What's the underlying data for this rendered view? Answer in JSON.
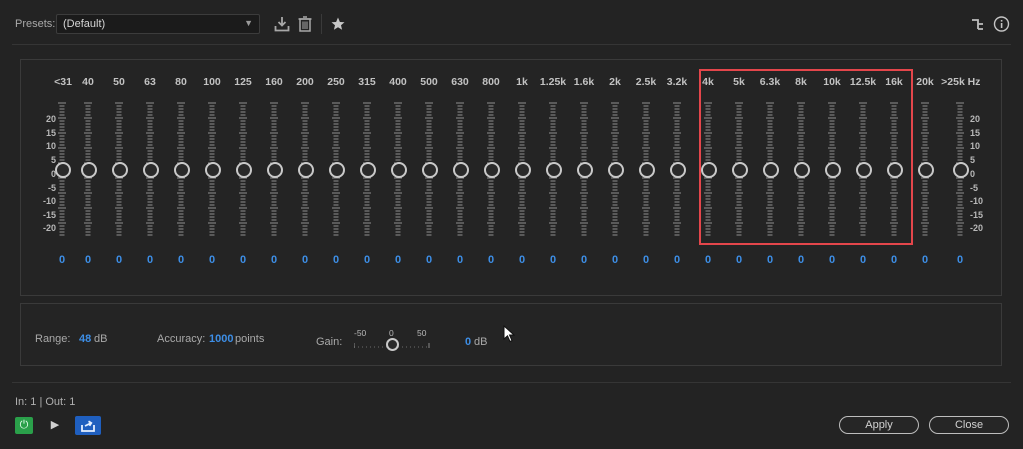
{
  "header": {
    "presets_label": "Presets:",
    "preset_value": "(Default)",
    "icons": [
      "save-preset-icon",
      "delete-preset-icon",
      "favorite-star-icon",
      "routing-icon",
      "info-icon"
    ]
  },
  "eq": {
    "bands": [
      "<31",
      "40",
      "50",
      "63",
      "80",
      "100",
      "125",
      "160",
      "200",
      "250",
      "315",
      "400",
      "500",
      "630",
      "800",
      "1k",
      "1.25k",
      "1.6k",
      "2k",
      "2.5k",
      "3.2k",
      "4k",
      "5k",
      "6.3k",
      "8k",
      "10k",
      "12.5k",
      "16k",
      "20k",
      ">25k"
    ],
    "unit": "Hz",
    "values": [
      "0",
      "0",
      "0",
      "0",
      "0",
      "0",
      "0",
      "0",
      "0",
      "0",
      "0",
      "0",
      "0",
      "0",
      "0",
      "0",
      "0",
      "0",
      "0",
      "0",
      "0",
      "0",
      "0",
      "0",
      "0",
      "0",
      "0",
      "0",
      "0",
      "0"
    ],
    "db_scale": [
      "20",
      "15",
      "10",
      "5",
      "0",
      "-5",
      "-10",
      "-15",
      "-20"
    ]
  },
  "settings": {
    "range_label": "Range:",
    "range_value": "48",
    "range_unit": "dB",
    "accuracy_label": "Accuracy:",
    "accuracy_value": "1000",
    "accuracy_unit": "points",
    "gain_label": "Gain:",
    "gain_ticks": [
      "-50",
      "0",
      "50"
    ],
    "gain_value": "0",
    "gain_unit": "dB"
  },
  "footer": {
    "io_text": "In: 1 | Out: 1",
    "apply_label": "Apply",
    "close_label": "Close"
  },
  "colors": {
    "accent_blue": "#3d8ee6",
    "highlight_red": "#e4464b",
    "power_green": "#2aa04a"
  }
}
